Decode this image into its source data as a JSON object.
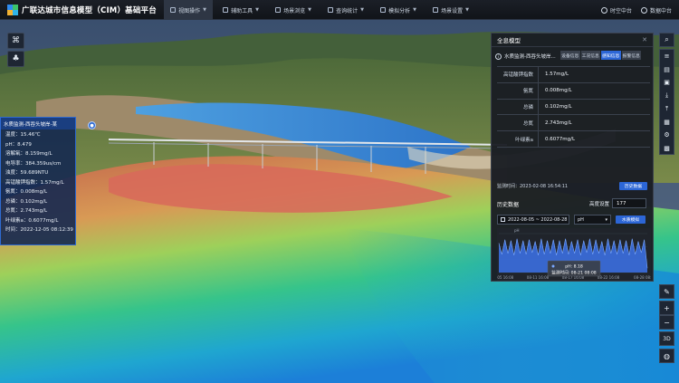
{
  "app": {
    "title": "广联达城市信息模型（CIM）基础平台"
  },
  "menu": [
    {
      "label": "视图操作",
      "icon": "view-icon",
      "active": true
    },
    {
      "label": "辅助工具",
      "icon": "tools-icon",
      "active": false
    },
    {
      "label": "场景浏览",
      "icon": "scene-icon",
      "active": false
    },
    {
      "label": "查询统计",
      "icon": "query-icon",
      "active": false
    },
    {
      "label": "模拟分析",
      "icon": "analysis-icon",
      "active": false
    },
    {
      "label": "场景设置",
      "icon": "settings-icon",
      "active": false
    }
  ],
  "top_right": {
    "time_center": "时空中台",
    "data_center": "数据中台"
  },
  "info_panel": {
    "title": "水质监测-西吞头坡岸-某",
    "rows": [
      "温度：15.46℃",
      "pH：8.479",
      "溶解氧：8.159mg/L",
      "电导率：384.359us/cm",
      "浊度：59.689NTU",
      "高锰酸钾指数：1.57mg/L",
      "氨氮：0.008mg/L",
      "总磷：0.102mg/L",
      "总氮：2.743mg/L",
      "叶绿素a：0.6077mg/L",
      "时间：2022-12-05 08:12:39"
    ]
  },
  "detail": {
    "header": "全息模型",
    "station": "水质监测-西吞头坡岸...",
    "tabs": [
      "设备信息",
      "工况信息",
      "感知信息",
      "报警信息"
    ],
    "active_tab": 2,
    "measurements": [
      {
        "name": "高锰酸钾指数",
        "value": "1.57mg/L"
      },
      {
        "name": "氨氮",
        "value": "0.008mg/L"
      },
      {
        "name": "总磷",
        "value": "0.102mg/L"
      },
      {
        "name": "总氮",
        "value": "2.743mg/L"
      },
      {
        "name": "叶绿素a",
        "value": "0.6077mg/L"
      }
    ],
    "monitor_time": "监测时间：2023-02-08 16:54:11",
    "history_button": "历史数据",
    "history_label": "历史数据",
    "threshold_label": "高度设置",
    "threshold_value": "177",
    "date_range": "2022-08-05  ~  2022-08-28",
    "param": "pH",
    "simulate_button": "水质模拟"
  },
  "chart_data": {
    "type": "area",
    "series_name": "pH",
    "ylabel": "pH",
    "ylim": [
      7.9,
      8.35
    ],
    "x_ticks": [
      "08-05 16:08",
      "08-11 16:08",
      "08-17 16:08",
      "08-22 16:08",
      "08-28 08:0"
    ],
    "x_range": [
      "2022-08-05 16:08",
      "2022-08-28 08:00"
    ],
    "values": [
      8.24,
      8.11,
      8.28,
      8.12,
      8.27,
      8.1,
      8.29,
      8.12,
      8.27,
      8.11,
      8.28,
      8.13,
      8.26,
      8.1,
      8.29,
      8.11,
      8.27,
      8.12,
      8.28,
      8.1,
      8.27,
      8.12,
      8.29,
      8.11,
      8.26,
      8.12,
      8.28,
      8.1,
      8.27,
      8.13,
      8.29,
      8.11,
      8.28,
      8.12,
      8.26,
      8.1,
      8.29,
      8.12,
      8.27,
      8.11,
      8.28,
      8.12,
      8.27,
      8.1,
      8.29,
      8.11,
      8.26,
      8.13,
      8.28,
      7.95
    ],
    "tooltip": {
      "value_text": "pH: 8.18",
      "time_text": "监测时间: 08-21 08:08"
    },
    "fill_color": "#3b6fe0",
    "line_color": "#7aa8ff"
  },
  "right_tools": [
    "search-icon",
    "layers-icon",
    "print-icon",
    "image-icon",
    "download-icon",
    "upload-icon",
    "document-icon",
    "gear-icon",
    "grid-icon"
  ],
  "map_tools": {
    "zoom_in": "+",
    "zoom_out": "−",
    "mode_3d": "3D"
  }
}
